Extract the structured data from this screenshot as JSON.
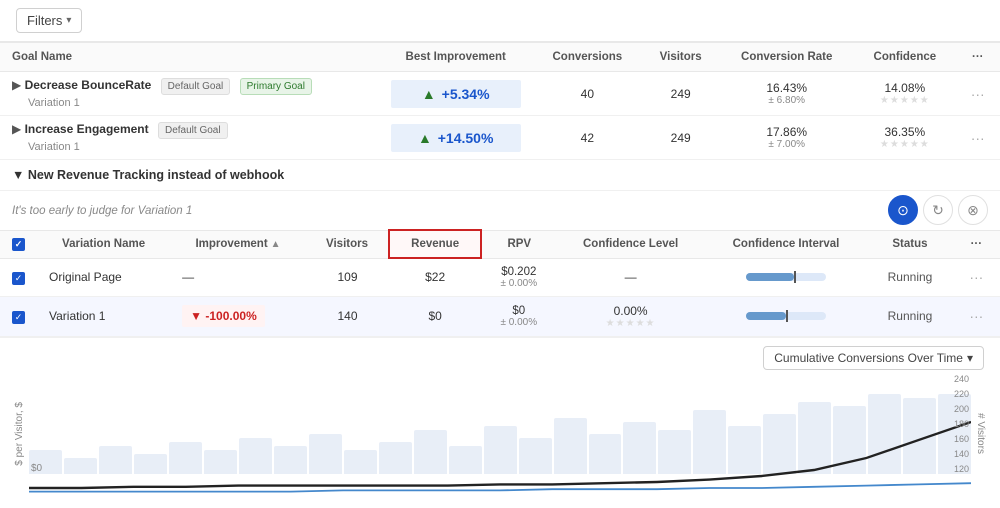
{
  "topbar": {
    "filters_label": "Filters",
    "chevron": "▾"
  },
  "goals_table": {
    "headers": {
      "goal_name": "Goal Name",
      "best_improvement": "Best Improvement",
      "conversions": "Conversions",
      "visitors": "Visitors",
      "conversion_rate": "Conversion Rate",
      "confidence": "Confidence",
      "more": "···"
    },
    "rows": [
      {
        "name": "Decrease BounceRate",
        "variation": "Variation 1",
        "badges": [
          "Default Goal",
          "Primary Goal"
        ],
        "best_improvement": "+5.34%",
        "conversions": "40",
        "visitors": "249",
        "conversion_rate": "16.43%",
        "conversion_rate_sub": "± 6.80%",
        "confidence": "14.08%",
        "stars": "★★★★★"
      },
      {
        "name": "Increase Engagement",
        "variation": "Variation 1",
        "badges": [
          "Default Goal"
        ],
        "best_improvement": "+14.50%",
        "conversions": "42",
        "visitors": "249",
        "conversion_rate": "17.86%",
        "conversion_rate_sub": "± 7.00%",
        "confidence": "36.35%",
        "stars": "★★★★★"
      }
    ]
  },
  "revenue_section": {
    "title": "New Revenue Tracking instead of webhook",
    "early_judge": "It's too early to judge for",
    "early_judge_var": "Variation 1",
    "inner_table": {
      "headers": {
        "variation_name": "Variation Name",
        "improvement": "Improvement",
        "improvement_sort": "▲",
        "visitors": "Visitors",
        "revenue": "Revenue",
        "rpv": "RPV",
        "confidence_level": "Confidence Level",
        "confidence_interval": "Confidence Interval",
        "status": "Status",
        "more": "···"
      },
      "rows": [
        {
          "checkbox": true,
          "name": "Original Page",
          "improvement": "—",
          "visitors": "109",
          "revenue": "$22",
          "rpv": "$0.202",
          "rpv_sub": "± 0.00%",
          "confidence_level": "—",
          "bar_fill": 60,
          "status": "Running"
        },
        {
          "checkbox": true,
          "name": "Variation 1",
          "improvement": "▼ -100.00%",
          "visitors": "140",
          "revenue": "$0",
          "rpv": "$0",
          "rpv_sub": "± 0.00%",
          "confidence_level": "0.00%",
          "confidence_stars": "★★★★★",
          "bar_fill": 50,
          "status": "Running"
        }
      ]
    }
  },
  "chart": {
    "dropdown_label": "Cumulative Conversions Over Time",
    "chevron": "▾",
    "y_label_left": "$ per Visitor, $",
    "y_label_right": "# Visitors",
    "x_label_zero": "$0",
    "y_ticks_right": [
      "240",
      "220",
      "200",
      "180",
      "160",
      "140",
      "120"
    ],
    "bars": [
      30,
      20,
      35,
      25,
      40,
      30,
      45,
      35,
      50,
      30,
      40,
      55,
      35,
      60,
      45,
      70,
      50,
      65,
      55,
      80,
      60,
      75,
      90,
      85,
      100,
      95,
      100
    ]
  },
  "toggle_buttons": [
    {
      "icon": "⊙",
      "active": true
    },
    {
      "icon": "⟳",
      "active": false
    },
    {
      "icon": "⊗",
      "active": false
    }
  ]
}
